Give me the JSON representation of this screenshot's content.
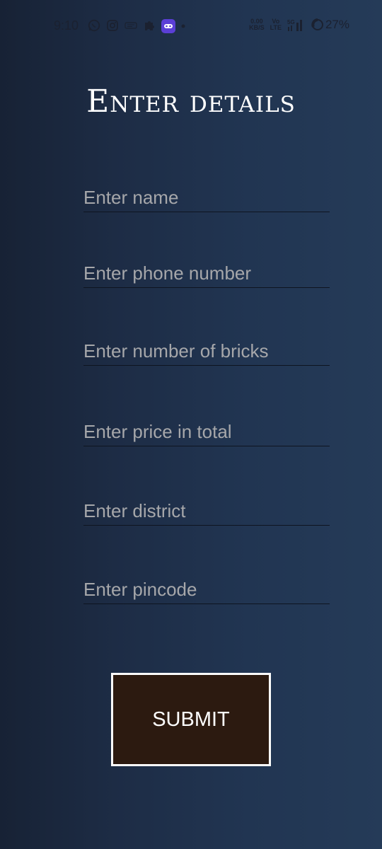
{
  "status_bar": {
    "time": "9:10",
    "left_icons": [
      "whatsapp-icon",
      "instagram-icon",
      "chat-icon",
      "puzzle-icon",
      "app-icon",
      "dot-icon"
    ],
    "net_speed_value": "0.00",
    "net_speed_unit": "KB/S",
    "volte_label": "Vo\nLTE",
    "network_label": "5G",
    "battery": "27%"
  },
  "page": {
    "title": "Enter details"
  },
  "form": {
    "fields": [
      {
        "placeholder": "Enter name",
        "value": ""
      },
      {
        "placeholder": "Enter phone number",
        "value": ""
      },
      {
        "placeholder": "Enter number of bricks",
        "value": ""
      },
      {
        "placeholder": "Enter price in total",
        "value": ""
      },
      {
        "placeholder": "Enter district",
        "value": ""
      },
      {
        "placeholder": "Enter pincode",
        "value": ""
      }
    ],
    "submit_label": "SUBMIT"
  },
  "colors": {
    "background_dark": "#172235",
    "background_light": "#253b58",
    "button_fill": "#2c1a10",
    "button_border": "#ffffff",
    "placeholder": "#a6a7aa"
  }
}
